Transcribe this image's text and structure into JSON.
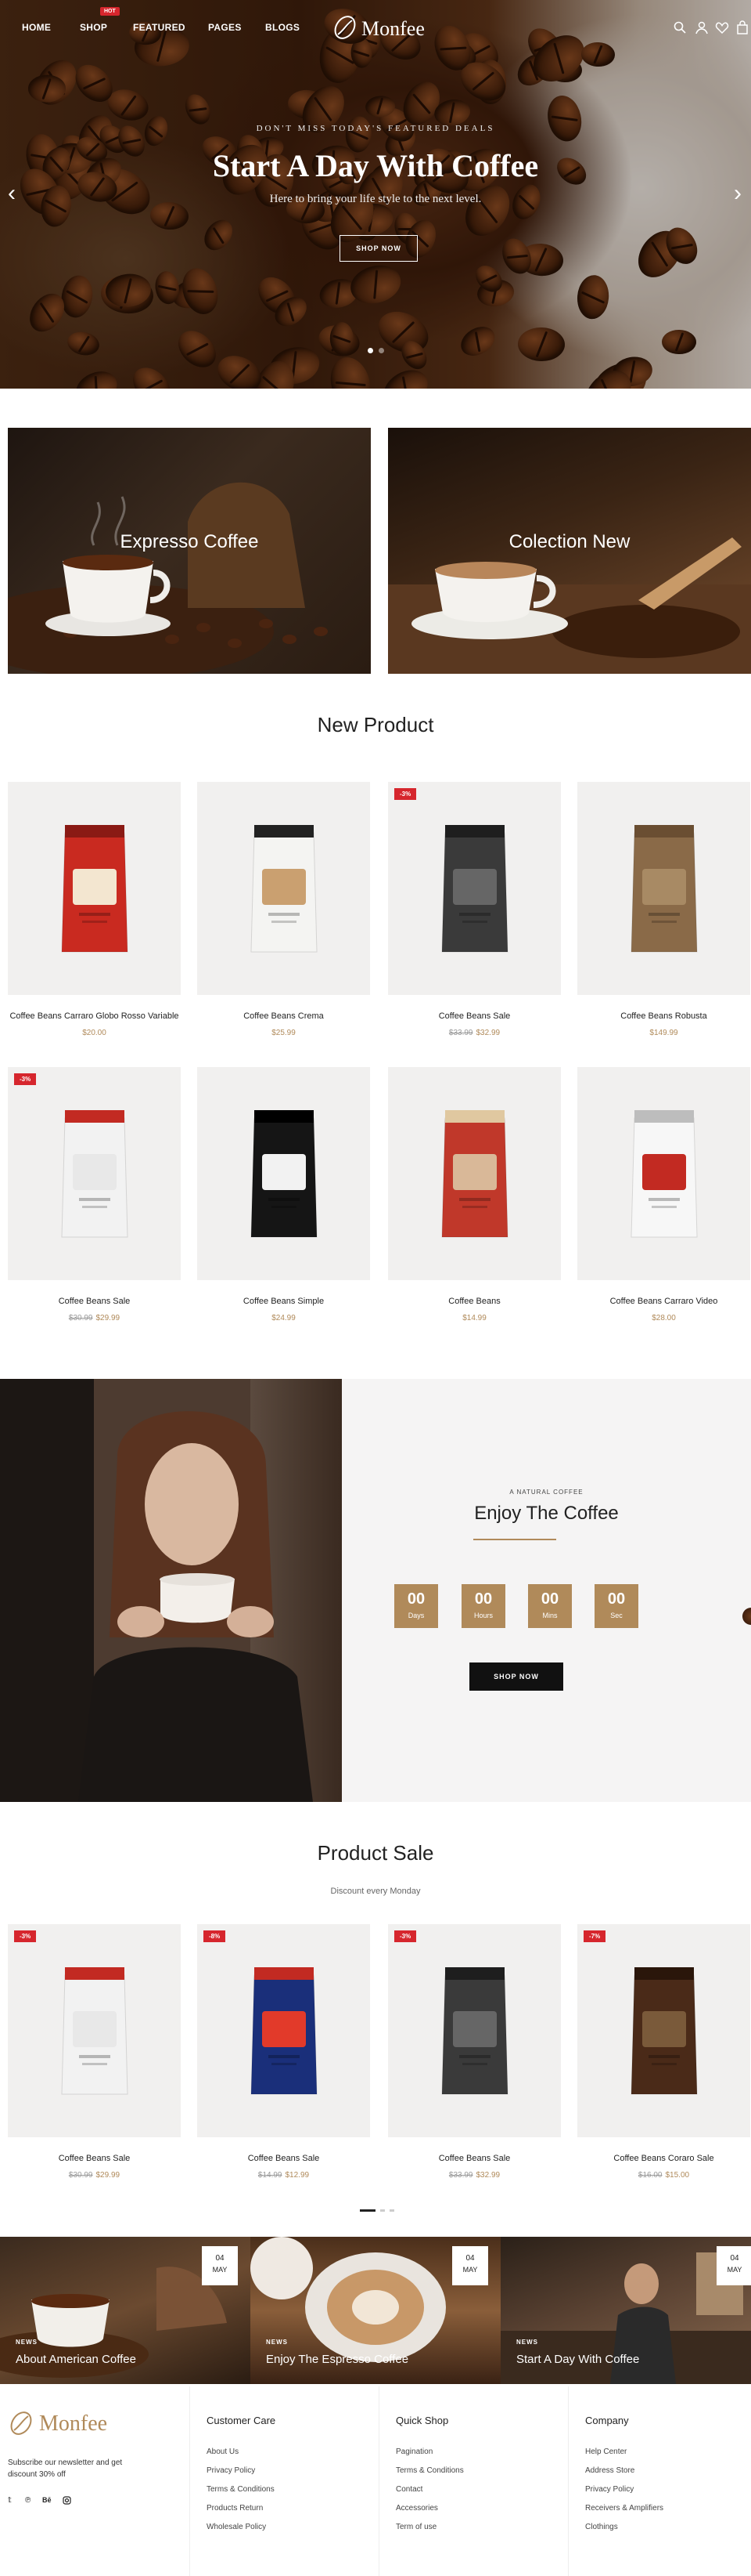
{
  "nav": {
    "links": [
      "HOME",
      "SHOP",
      "FEATURED",
      "PAGES",
      "BLOGS"
    ],
    "hot_badge": "HOT",
    "logo_text": "Monfee"
  },
  "hero": {
    "subtitle": "DON'T MISS TODAY'S FEATURED DEALS",
    "title": "Start A Day With Coffee",
    "text": "Here to bring your life style to the next level.",
    "button": "SHOP NOW"
  },
  "banners": [
    "Expresso Coffee",
    "Colection New"
  ],
  "new_product": {
    "title": "New Product",
    "items": [
      {
        "name": "Coffee Beans Carraro Globo Rosso Variable",
        "old_price": "",
        "price": "$20.00",
        "badge": ""
      },
      {
        "name": "Coffee Beans Crema",
        "old_price": "",
        "price": "$25.99",
        "badge": ""
      },
      {
        "name": "Coffee Beans Sale",
        "old_price": "$33.99",
        "price": "$32.99",
        "badge": "-3%"
      },
      {
        "name": "Coffee Beans Robusta",
        "old_price": "",
        "price": "$149.99",
        "badge": ""
      },
      {
        "name": "Coffee Beans Sale",
        "old_price": "$30.99",
        "price": "$29.99",
        "badge": "-3%"
      },
      {
        "name": "Coffee Beans Simple",
        "old_price": "",
        "price": "$24.99",
        "badge": ""
      },
      {
        "name": "Coffee Beans",
        "old_price": "",
        "price": "$14.99",
        "badge": ""
      },
      {
        "name": "Coffee Beans Carraro Video",
        "old_price": "",
        "price": "$28.00",
        "badge": ""
      }
    ]
  },
  "enjoy": {
    "kicker": "A NATURAL COFFEE",
    "title": "Enjoy The Coffee",
    "countdown": [
      {
        "value": "00",
        "label": "Days"
      },
      {
        "value": "00",
        "label": "Hours"
      },
      {
        "value": "00",
        "label": "Mins"
      },
      {
        "value": "00",
        "label": "Sec"
      }
    ],
    "button": "SHOP NOW"
  },
  "product_sale": {
    "title": "Product Sale",
    "subtitle": "Discount every Monday",
    "items": [
      {
        "name": "Coffee Beans Sale",
        "old_price": "$30.99",
        "price": "$29.99",
        "badge": "-3%"
      },
      {
        "name": "Coffee Beans Sale",
        "old_price": "$14.99",
        "price": "$12.99",
        "badge": "-8%"
      },
      {
        "name": "Coffee Beans Sale",
        "old_price": "$33.99",
        "price": "$32.99",
        "badge": "-3%"
      },
      {
        "name": "Coffee Beans Coraro Sale",
        "old_price": "$16.00",
        "price": "$15.00",
        "badge": "-7%"
      }
    ]
  },
  "news": [
    {
      "category": "NEWS",
      "title": "About American Coffee",
      "day": "04",
      "month": "MAY"
    },
    {
      "category": "NEWS",
      "title": "Enjoy The Espresso Coffee",
      "day": "04",
      "month": "MAY"
    },
    {
      "category": "NEWS",
      "title": "Start A Day With Coffee",
      "day": "04",
      "month": "MAY"
    }
  ],
  "footer": {
    "logo_text": "Monfee",
    "newsletter": "Subscribe our newsletter and get discount 30% off",
    "social": [
      "twitter-icon",
      "pinterest-icon",
      "behance-icon",
      "instagram-icon"
    ],
    "columns": [
      {
        "title": "Customer Care",
        "items": [
          "About Us",
          "Privacy Policy",
          "Terms & Conditions",
          "Products Return",
          "Wholesale Policy"
        ]
      },
      {
        "title": "Quick Shop",
        "items": [
          "Pagination",
          "Terms & Conditions",
          "Contact",
          "Accessories",
          "Term of use"
        ]
      },
      {
        "title": "Company",
        "items": [
          "Help Center",
          "Address Store",
          "Privacy Policy",
          "Receivers & Amplifiers",
          "Clothings"
        ]
      }
    ]
  },
  "colors": {
    "accent": "#b08a5a",
    "sale": "#d6262d",
    "dark": "#111111"
  }
}
